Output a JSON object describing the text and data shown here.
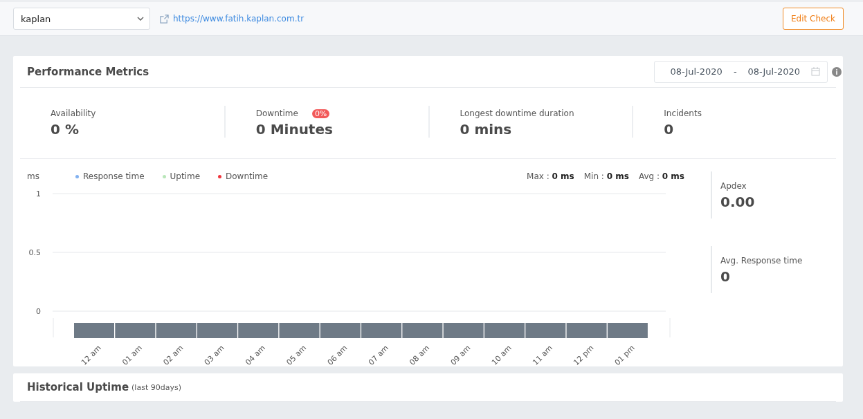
{
  "topbar": {
    "monitor_select": {
      "value": "kaplan"
    },
    "url": "https://www.fatih.kaplan.com.tr",
    "edit_button": "Edit Check"
  },
  "performance": {
    "title": "Performance Metrics",
    "date_from": "08-Jul-2020",
    "date_separator": "-",
    "date_to": "08-Jul-2020",
    "stats": [
      {
        "label": "Availability",
        "value": "0 %"
      },
      {
        "label": "Downtime",
        "value": "0 Minutes",
        "badge": "0%"
      },
      {
        "label": "Longest downtime duration",
        "value": "0 mins"
      },
      {
        "label": "Incidents",
        "value": "0"
      }
    ],
    "summary": [
      {
        "label": "Max :",
        "value": "0 ms"
      },
      {
        "label": "Min :",
        "value": "0 ms"
      },
      {
        "label": "Avg :",
        "value": "0 ms"
      }
    ],
    "side_stats": [
      {
        "label": "Apdex",
        "value": "0.00"
      },
      {
        "label": "Avg. Response time",
        "value": "0"
      }
    ],
    "chart_data": {
      "type": "line",
      "ylabel": "ms",
      "categories": [
        "12 am",
        "01 am",
        "02 am",
        "03 am",
        "04 am",
        "05 am",
        "06 am",
        "07 am",
        "08 am",
        "09 am",
        "10 am",
        "11 am",
        "12 pm",
        "01 pm"
      ],
      "ylim": [
        0,
        1
      ],
      "yticks": [
        0,
        0.5,
        1
      ],
      "series": [
        {
          "name": "Response time",
          "color": "#82b1f0",
          "values": [
            null,
            null,
            null,
            null,
            null,
            null,
            null,
            null,
            null,
            null,
            null,
            null,
            null,
            null
          ]
        },
        {
          "name": "Uptime",
          "color": "#b9e6b9",
          "values": [
            null,
            null,
            null,
            null,
            null,
            null,
            null,
            null,
            null,
            null,
            null,
            null,
            null,
            null
          ]
        },
        {
          "name": "Downtime",
          "color": "#f0353d",
          "values": [
            null,
            null,
            null,
            null,
            null,
            null,
            null,
            null,
            null,
            null,
            null,
            null,
            null,
            null
          ]
        }
      ]
    }
  },
  "historical": {
    "title": "Historical Uptime",
    "subtitle": "(last 90days)"
  }
}
